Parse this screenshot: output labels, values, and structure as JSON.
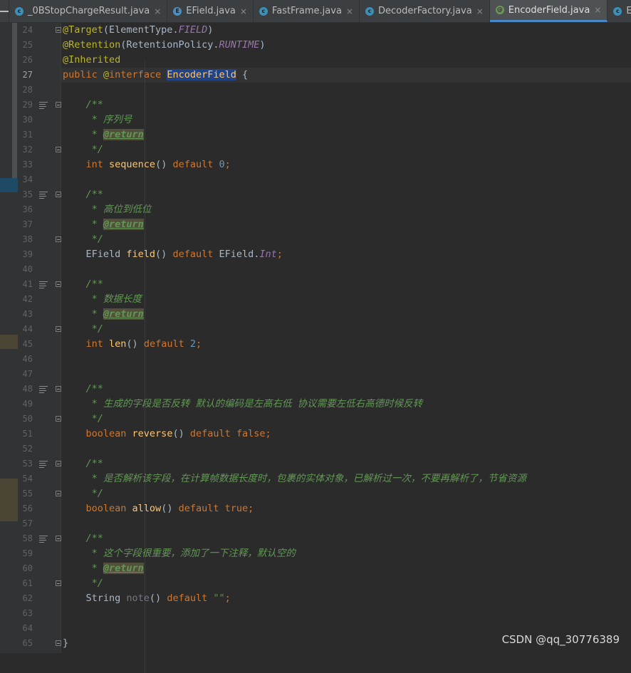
{
  "tabs": [
    {
      "label": "_0BStopChargeResult.java",
      "icon": "class-icon",
      "active": false
    },
    {
      "label": "EField.java",
      "icon": "enum-icon",
      "active": false
    },
    {
      "label": "FastFrame.java",
      "icon": "class-icon",
      "active": false
    },
    {
      "label": "DecoderFactory.java",
      "icon": "class-icon",
      "active": false
    },
    {
      "label": "EncoderField.java",
      "icon": "annotation-icon",
      "active": true
    },
    {
      "label": "EncoderFac",
      "icon": "class-icon",
      "active": false
    }
  ],
  "current_line": "27",
  "lines": [
    {
      "n": "24",
      "t": [
        [
          "ann",
          "@Target"
        ],
        [
          "plain",
          "(ElementType."
        ],
        [
          "const",
          "FIELD"
        ],
        [
          "plain",
          ")"
        ]
      ]
    },
    {
      "n": "25",
      "t": [
        [
          "ann",
          "@Retention"
        ],
        [
          "plain",
          "(RetentionPolicy."
        ],
        [
          "const",
          "RUNTIME"
        ],
        [
          "plain",
          ")"
        ]
      ]
    },
    {
      "n": "26",
      "t": [
        [
          "ann",
          "@Inherited"
        ]
      ]
    },
    {
      "n": "27",
      "t": [
        [
          "kw",
          "public "
        ],
        [
          "ann",
          "@"
        ],
        [
          "kw",
          "interface "
        ],
        [
          "sel",
          "EncoderField"
        ],
        [
          "plain",
          " {"
        ]
      ]
    },
    {
      "n": "28",
      "t": []
    },
    {
      "n": "29",
      "t": [
        [
          "doc",
          "    /**"
        ]
      ]
    },
    {
      "n": "30",
      "t": [
        [
          "doc",
          "     * 序列号"
        ]
      ]
    },
    {
      "n": "31",
      "t": [
        [
          "doc",
          "     * "
        ],
        [
          "tag",
          "@return"
        ]
      ]
    },
    {
      "n": "32",
      "t": [
        [
          "doc",
          "     */"
        ]
      ]
    },
    {
      "n": "33",
      "t": [
        [
          "kw",
          "    int "
        ],
        [
          "method",
          "sequence"
        ],
        [
          "plain",
          "() "
        ],
        [
          "kw",
          "default "
        ],
        [
          "num",
          "0"
        ],
        [
          "kw",
          ";"
        ]
      ]
    },
    {
      "n": "34",
      "t": []
    },
    {
      "n": "35",
      "t": [
        [
          "doc",
          "    /**"
        ]
      ]
    },
    {
      "n": "36",
      "t": [
        [
          "doc",
          "     * 高位到低位"
        ]
      ]
    },
    {
      "n": "37",
      "t": [
        [
          "doc",
          "     * "
        ],
        [
          "tag",
          "@return"
        ]
      ]
    },
    {
      "n": "38",
      "t": [
        [
          "doc",
          "     */"
        ]
      ]
    },
    {
      "n": "39",
      "t": [
        [
          "plain",
          "    EField "
        ],
        [
          "method",
          "field"
        ],
        [
          "plain",
          "() "
        ],
        [
          "kw",
          "default "
        ],
        [
          "plain",
          "EField."
        ],
        [
          "const",
          "Int"
        ],
        [
          "kw",
          ";"
        ]
      ]
    },
    {
      "n": "40",
      "t": []
    },
    {
      "n": "41",
      "t": [
        [
          "doc",
          "    /**"
        ]
      ]
    },
    {
      "n": "42",
      "t": [
        [
          "doc",
          "     * 数据长度"
        ]
      ]
    },
    {
      "n": "43",
      "t": [
        [
          "doc",
          "     * "
        ],
        [
          "tag",
          "@return"
        ]
      ]
    },
    {
      "n": "44",
      "t": [
        [
          "doc",
          "     */"
        ]
      ]
    },
    {
      "n": "45",
      "t": [
        [
          "kw",
          "    int "
        ],
        [
          "method",
          "len"
        ],
        [
          "plain",
          "() "
        ],
        [
          "kw",
          "default "
        ],
        [
          "num",
          "2"
        ],
        [
          "kw",
          ";"
        ]
      ]
    },
    {
      "n": "46",
      "t": []
    },
    {
      "n": "47",
      "t": []
    },
    {
      "n": "48",
      "t": [
        [
          "doc",
          "    /**"
        ]
      ]
    },
    {
      "n": "49",
      "t": [
        [
          "doc",
          "     * 生成的字段是否反转 默认的编码是左高右低 协议需要左低右高德时候反转"
        ]
      ]
    },
    {
      "n": "50",
      "t": [
        [
          "doc",
          "     */"
        ]
      ]
    },
    {
      "n": "51",
      "t": [
        [
          "kw",
          "    boolean "
        ],
        [
          "method",
          "reverse"
        ],
        [
          "plain",
          "() "
        ],
        [
          "kw",
          "default false;"
        ]
      ]
    },
    {
      "n": "52",
      "t": []
    },
    {
      "n": "53",
      "t": [
        [
          "doc",
          "    /**"
        ]
      ]
    },
    {
      "n": "54",
      "t": [
        [
          "doc",
          "     * 是否解析该字段，在计算帧数据长度时，包裹的实体对象，已解析过一次，不要再解析了，节省资源"
        ]
      ]
    },
    {
      "n": "55",
      "t": [
        [
          "doc",
          "     */"
        ]
      ]
    },
    {
      "n": "56",
      "t": [
        [
          "kw",
          "    boolean "
        ],
        [
          "method",
          "allow"
        ],
        [
          "plain",
          "() "
        ],
        [
          "kw",
          "default true;"
        ]
      ]
    },
    {
      "n": "57",
      "t": []
    },
    {
      "n": "58",
      "t": [
        [
          "doc",
          "    /**"
        ]
      ]
    },
    {
      "n": "59",
      "t": [
        [
          "doc",
          "     * 这个字段很重要，添加了一下注释，默认空的"
        ]
      ]
    },
    {
      "n": "60",
      "t": [
        [
          "doc",
          "     * "
        ],
        [
          "tag",
          "@return"
        ]
      ]
    },
    {
      "n": "61",
      "t": [
        [
          "doc",
          "     */"
        ]
      ]
    },
    {
      "n": "62",
      "t": [
        [
          "plain",
          "    String "
        ],
        [
          "meth-dim",
          "note"
        ],
        [
          "plain",
          "() "
        ],
        [
          "kw",
          "default "
        ],
        [
          "str",
          "\"\""
        ],
        [
          "kw",
          ";"
        ]
      ]
    },
    {
      "n": "63",
      "t": []
    },
    {
      "n": "64",
      "t": []
    },
    {
      "n": "65",
      "t": [
        [
          "plain",
          "}"
        ]
      ]
    }
  ],
  "doc_marker_lines": [
    "29",
    "35",
    "41",
    "48",
    "53",
    "58"
  ],
  "fold_lines": [
    "24",
    "29",
    "32",
    "35",
    "38",
    "41",
    "44",
    "48",
    "50",
    "53",
    "55",
    "58",
    "61",
    "65"
  ],
  "watermark": "CSDN @qq_30776389",
  "colors": {
    "background": "#2b2b2b",
    "keyword": "#cc7832",
    "annotation": "#bbb529",
    "doc_comment": "#629755",
    "number": "#6897bb",
    "method": "#ffc66d",
    "constant": "#9876aa"
  }
}
